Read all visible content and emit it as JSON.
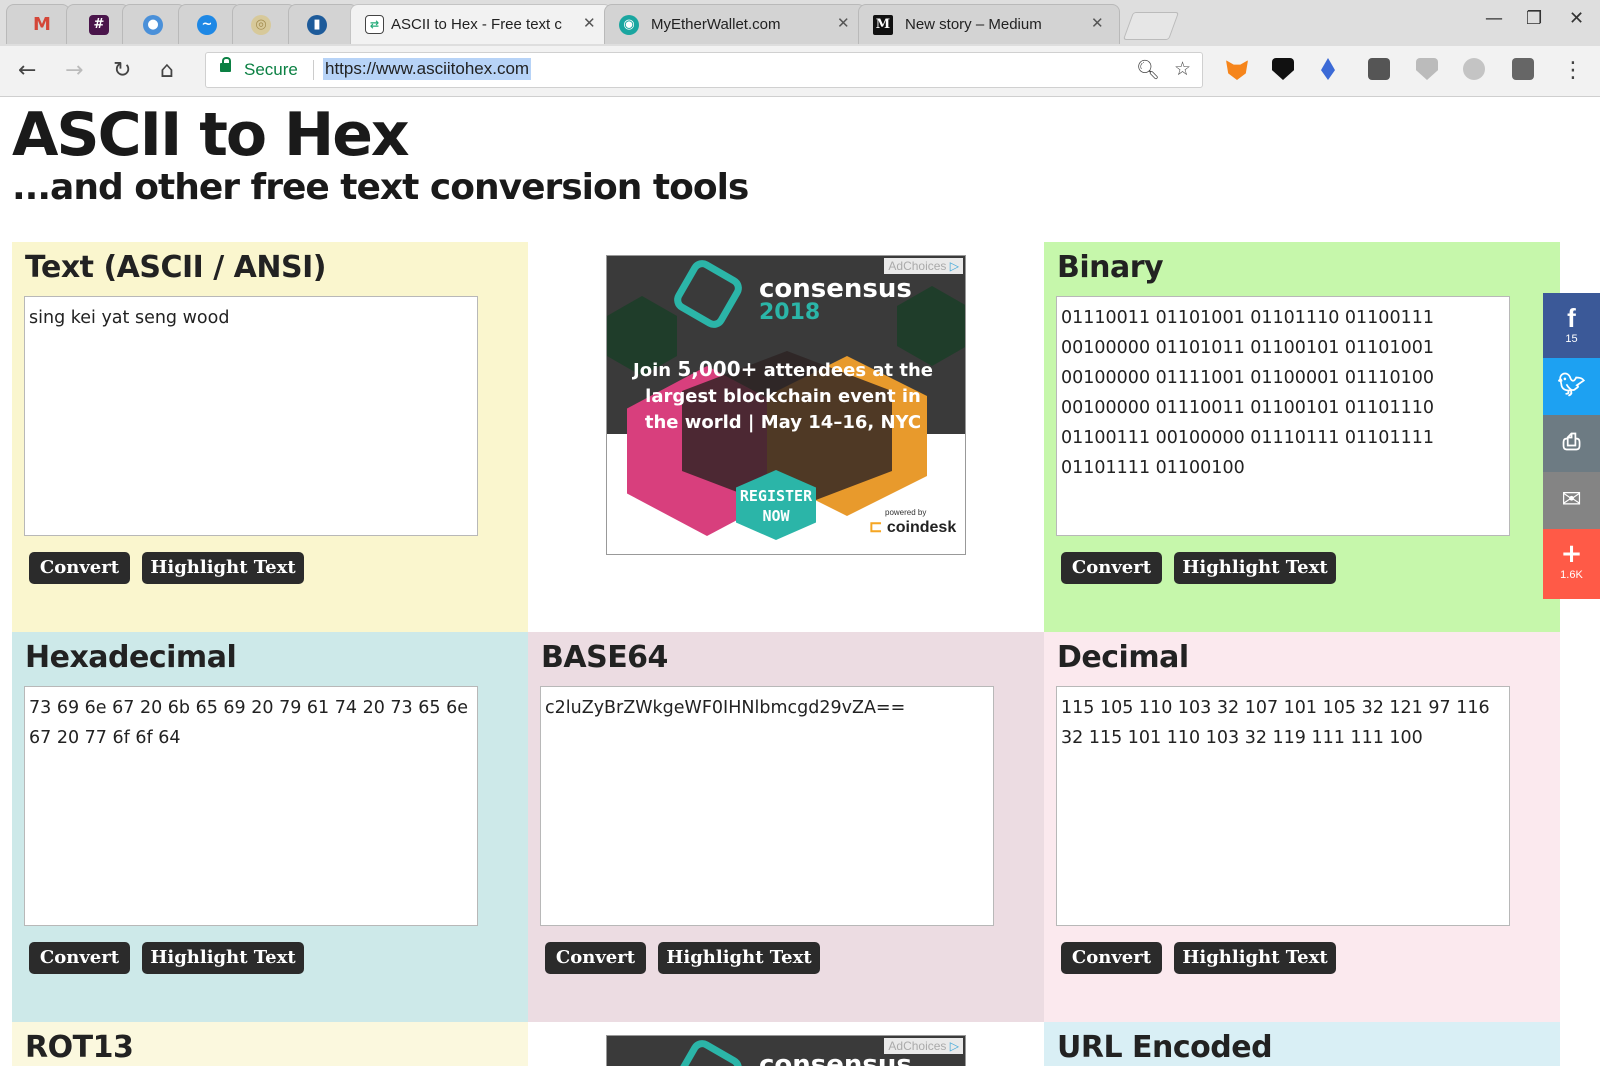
{
  "browser": {
    "tabs": [
      {
        "title": "",
        "icon": "gmail-icon"
      },
      {
        "title": "",
        "icon": "slack-icon"
      },
      {
        "title": "",
        "icon": "chat-icon"
      },
      {
        "title": "",
        "icon": "messenger-icon"
      },
      {
        "title": "",
        "icon": "coin-icon"
      },
      {
        "title": "",
        "icon": "chart-icon"
      },
      {
        "title": "ASCII to Hex - Free text c",
        "icon": "asciitohex-favicon"
      },
      {
        "title": "MyEtherWallet.com",
        "icon": "myetherwallet-favicon"
      },
      {
        "title": "New story – Medium",
        "icon": "medium-favicon"
      }
    ],
    "secure_label": "Secure",
    "url": "https://www.asciitohex.com"
  },
  "page": {
    "title": "ASCII to Hex",
    "subtitle": "...and other free text conversion tools"
  },
  "panels": {
    "text": {
      "title": "Text (ASCII / ANSI)",
      "value": "sing kei yat seng wood",
      "convert": "Convert",
      "highlight": "Highlight Text",
      "color": "#faf6ce"
    },
    "binary": {
      "title": "Binary",
      "value": "01110011 01101001 01101110 01100111 00100000 01101011 01100101 01101001 00100000 01111001 01100001 01110100 00100000 01110011 01100101 01101110 01100111 00100000 01110111 01101111 01101111 01100100",
      "convert": "Convert",
      "highlight": "Highlight Text",
      "color": "#c6f7ab"
    },
    "hex": {
      "title": "Hexadecimal",
      "value": "73 69 6e 67 20 6b 65 69 20 79 61 74 20 73 65 6e 67 20 77 6f 6f 64",
      "convert": "Convert",
      "highlight": "Highlight Text",
      "color": "#cde9e9"
    },
    "base64": {
      "title": "BASE64",
      "value": "c2luZyBrZWkgeWF0IHNlbmcgd29vZA==",
      "convert": "Convert",
      "highlight": "Highlight Text",
      "color": "#ecdce2"
    },
    "decimal": {
      "title": "Decimal",
      "value": "115 105 110 103 32 107 101 105 32 121 97 116 32 115 101 110 103 32 119 111 111 100",
      "convert": "Convert",
      "highlight": "Highlight Text",
      "color": "#fbe9ee"
    },
    "rot13": {
      "title": "ROT13",
      "color": "#fbf8de"
    },
    "url_encoded": {
      "title": "URL Encoded",
      "color": "#d9eff5"
    }
  },
  "ad": {
    "adchoices": "AdChoices",
    "brand": "consensus",
    "year": "2018",
    "text_pre": "Join ",
    "text_bold": "5,000+",
    "text_post": " attendees at the largest blockchain event in the world | May 14–16, NYC",
    "cta_line1": "REGISTER",
    "cta_line2": "NOW",
    "powered": "powered by",
    "sponsor": "coindesk"
  },
  "share": {
    "facebook_count": "15",
    "more_count": "1.6K",
    "colors": {
      "facebook": "#3b5998",
      "twitter": "#1da1f2",
      "print": "#6d7b83",
      "email": "#848484",
      "more": "#ff5a47"
    }
  }
}
